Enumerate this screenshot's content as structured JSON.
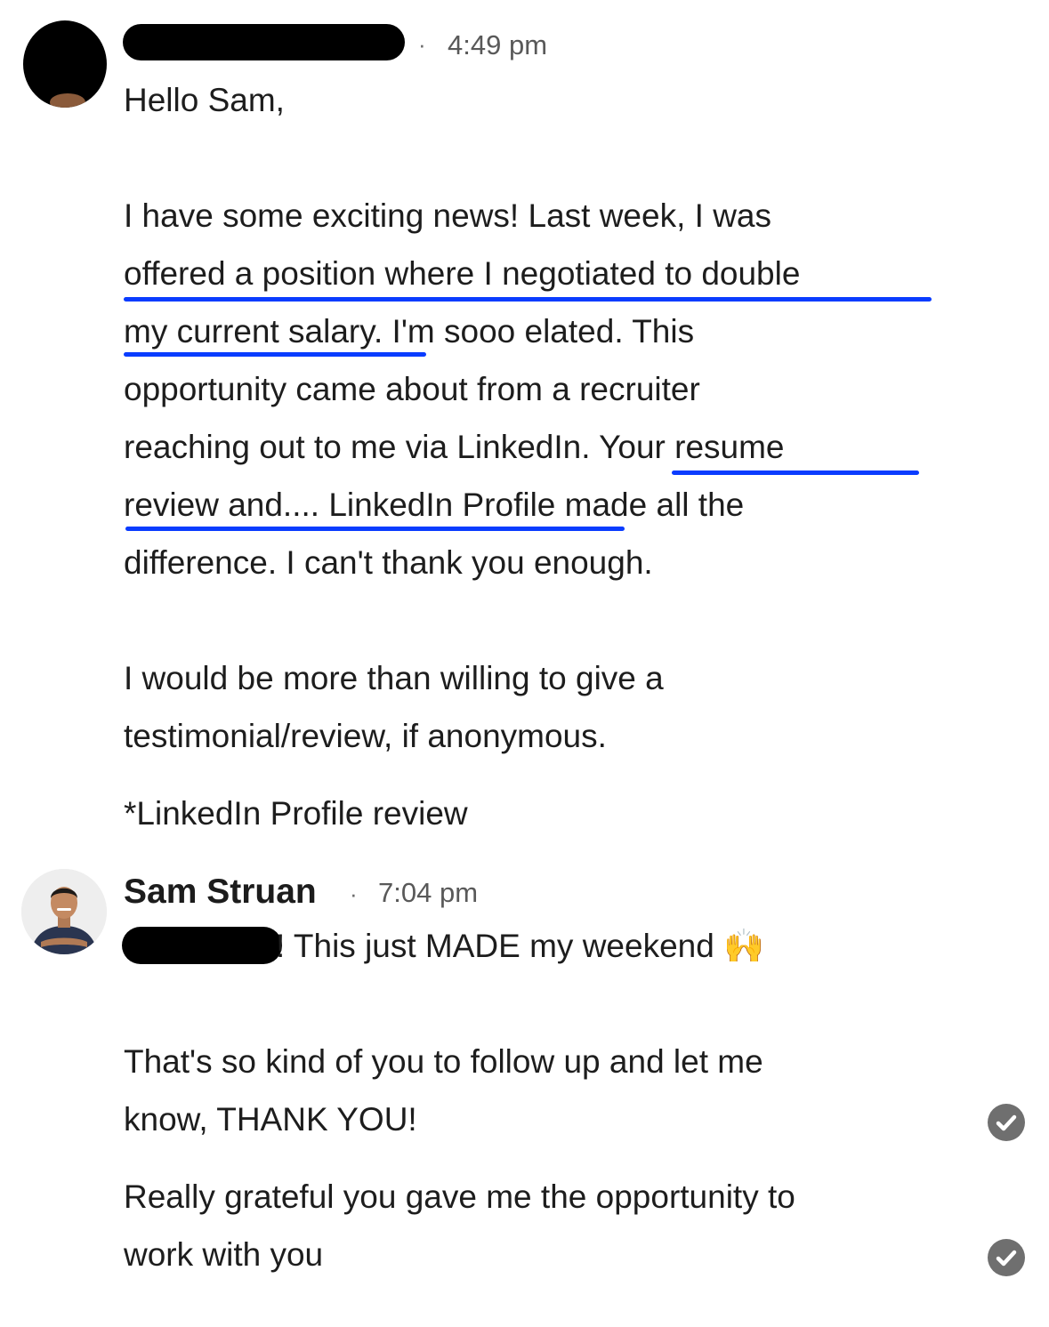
{
  "messages": [
    {
      "time": "4:49 pm",
      "separator": "·",
      "lines": [
        "Hello Sam,",
        "I have some exciting news! Last week, I was",
        "offered a position where I negotiated to double",
        "my current salary.  I'm sooo elated.  This",
        "opportunity came about from a recruiter",
        "reaching out to me via LinkedIn.  Your resume",
        "review and.... LinkedIn Profile made all the",
        "difference.  I can't thank you enough.",
        "I would be more than willing to give a",
        "testimonial/review, if anonymous.",
        "*LinkedIn Profile review"
      ]
    },
    {
      "sender": "Sam Struan",
      "time": "7:04 pm",
      "separator": "·",
      "lines": [
        "! This just MADE my weekend 🙌",
        "That's so kind of you to follow up and let me",
        "know, THANK YOU!",
        "Really grateful you gave me the opportunity to",
        "work with you"
      ]
    }
  ],
  "icons": {
    "read_receipt": "check-circle-icon",
    "emoji": "raising-hands-emoji"
  },
  "colors": {
    "underline_annotation": "#0a3cff",
    "read_receipt": "#6f6f6f"
  }
}
